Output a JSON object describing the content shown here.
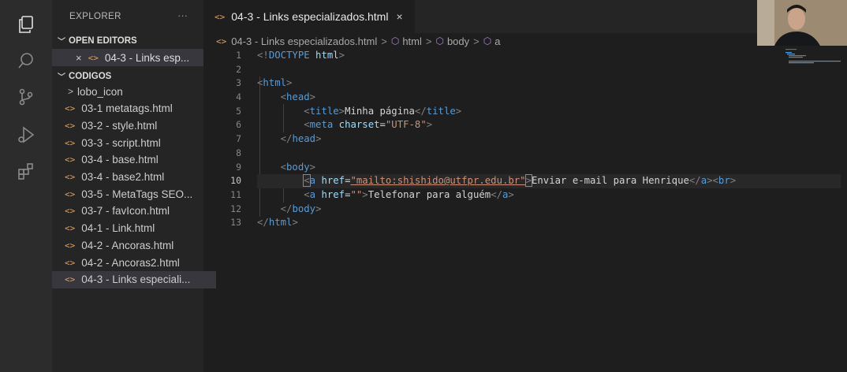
{
  "sidebar": {
    "title": "EXPLORER",
    "more": "···",
    "open_editors": {
      "header": "OPEN EDITORS",
      "items": [
        {
          "label": "04-3 - Links esp...",
          "icon": "html-file-icon"
        }
      ]
    },
    "folder": {
      "header": "CODIGOS",
      "items": [
        {
          "label": "lobo_icon",
          "type": "folder"
        },
        {
          "label": "03-1 metatags.html",
          "type": "file"
        },
        {
          "label": "03-2 - style.html",
          "type": "file"
        },
        {
          "label": "03-3 - script.html",
          "type": "file"
        },
        {
          "label": "03-4 - base.html",
          "type": "file"
        },
        {
          "label": "03-4 - base2.html",
          "type": "file"
        },
        {
          "label": "03-5 - MetaTags SEO...",
          "type": "file"
        },
        {
          "label": "03-7 - favIcon.html",
          "type": "file"
        },
        {
          "label": "04-1 - Link.html",
          "type": "file"
        },
        {
          "label": "04-2 - Ancoras.html",
          "type": "file"
        },
        {
          "label": "04-2 - Ancoras2.html",
          "type": "file"
        },
        {
          "label": "04-3 - Links especiali...",
          "type": "file",
          "active": true
        }
      ]
    }
  },
  "tab": {
    "label": "04-3 - Links especializados.html",
    "close": "×"
  },
  "breadcrumb": {
    "file": "04-3 - Links especializados.html",
    "items": [
      "html",
      "body",
      "a"
    ],
    "sep": ">"
  },
  "editor": {
    "current_line": 10,
    "line_numbers": [
      "1",
      "2",
      "3",
      "4",
      "5",
      "6",
      "7",
      "8",
      "9",
      "10",
      "11",
      "12",
      "13"
    ],
    "lines": [
      [
        {
          "c": "g",
          "t": "<!"
        },
        {
          "c": "t",
          "t": "DOCTYPE"
        },
        {
          "c": "w",
          "t": " "
        },
        {
          "c": "a",
          "t": "html"
        },
        {
          "c": "g",
          "t": ">"
        }
      ],
      [],
      [
        {
          "c": "g",
          "t": "<"
        },
        {
          "c": "t",
          "t": "html"
        },
        {
          "c": "g",
          "t": ">"
        }
      ],
      [
        {
          "c": "w",
          "t": "    "
        },
        {
          "c": "g",
          "t": "<"
        },
        {
          "c": "t",
          "t": "head"
        },
        {
          "c": "g",
          "t": ">"
        }
      ],
      [
        {
          "c": "w",
          "t": "        "
        },
        {
          "c": "g",
          "t": "<"
        },
        {
          "c": "t",
          "t": "title"
        },
        {
          "c": "g",
          "t": ">"
        },
        {
          "c": "w",
          "t": "Minha página"
        },
        {
          "c": "g",
          "t": "</"
        },
        {
          "c": "t",
          "t": "title"
        },
        {
          "c": "g",
          "t": ">"
        }
      ],
      [
        {
          "c": "w",
          "t": "        "
        },
        {
          "c": "g",
          "t": "<"
        },
        {
          "c": "t",
          "t": "meta"
        },
        {
          "c": "w",
          "t": " "
        },
        {
          "c": "a",
          "t": "charset"
        },
        {
          "c": "w",
          "t": "="
        },
        {
          "c": "s",
          "t": "\"UTF-8\""
        },
        {
          "c": "g",
          "t": ">"
        }
      ],
      [
        {
          "c": "w",
          "t": "    "
        },
        {
          "c": "g",
          "t": "</"
        },
        {
          "c": "t",
          "t": "head"
        },
        {
          "c": "g",
          "t": ">"
        }
      ],
      [],
      [
        {
          "c": "w",
          "t": "    "
        },
        {
          "c": "g",
          "t": "<"
        },
        {
          "c": "t",
          "t": "body"
        },
        {
          "c": "g",
          "t": ">"
        }
      ],
      [
        {
          "c": "w",
          "t": "        "
        },
        {
          "c": "g bh",
          "t": "<"
        },
        {
          "c": "t",
          "t": "a"
        },
        {
          "c": "w",
          "t": " "
        },
        {
          "c": "a",
          "t": "href"
        },
        {
          "c": "w",
          "t": "="
        },
        {
          "c": "s link",
          "t": "\"mailto:shishido@utfpr.edu.br\""
        },
        {
          "c": "g bh",
          "t": ">"
        },
        {
          "c": "w",
          "t": "Enviar e-mail para Henrique"
        },
        {
          "c": "g",
          "t": "</"
        },
        {
          "c": "t",
          "t": "a"
        },
        {
          "c": "g",
          "t": ">"
        },
        {
          "c": "g",
          "t": "<"
        },
        {
          "c": "t",
          "t": "br"
        },
        {
          "c": "g",
          "t": ">"
        }
      ],
      [
        {
          "c": "w",
          "t": "        "
        },
        {
          "c": "g",
          "t": "<"
        },
        {
          "c": "t",
          "t": "a"
        },
        {
          "c": "w",
          "t": " "
        },
        {
          "c": "a",
          "t": "href"
        },
        {
          "c": "w",
          "t": "="
        },
        {
          "c": "s",
          "t": "\"\""
        },
        {
          "c": "g",
          "t": ">"
        },
        {
          "c": "w",
          "t": "Telefonar para alguém"
        },
        {
          "c": "g",
          "t": "</"
        },
        {
          "c": "t",
          "t": "a"
        },
        {
          "c": "g",
          "t": ">"
        }
      ],
      [
        {
          "c": "w",
          "t": "    "
        },
        {
          "c": "g",
          "t": "</"
        },
        {
          "c": "t",
          "t": "body"
        },
        {
          "c": "g",
          "t": ">"
        }
      ],
      [
        {
          "c": "g",
          "t": "</"
        },
        {
          "c": "t",
          "t": "html"
        },
        {
          "c": "g",
          "t": ">"
        }
      ]
    ]
  },
  "colors": {
    "accent": "#007acc",
    "tag": "#569cd6",
    "attr": "#9cdcfe",
    "string": "#ce9178",
    "html_icon": "#e2a05a"
  }
}
